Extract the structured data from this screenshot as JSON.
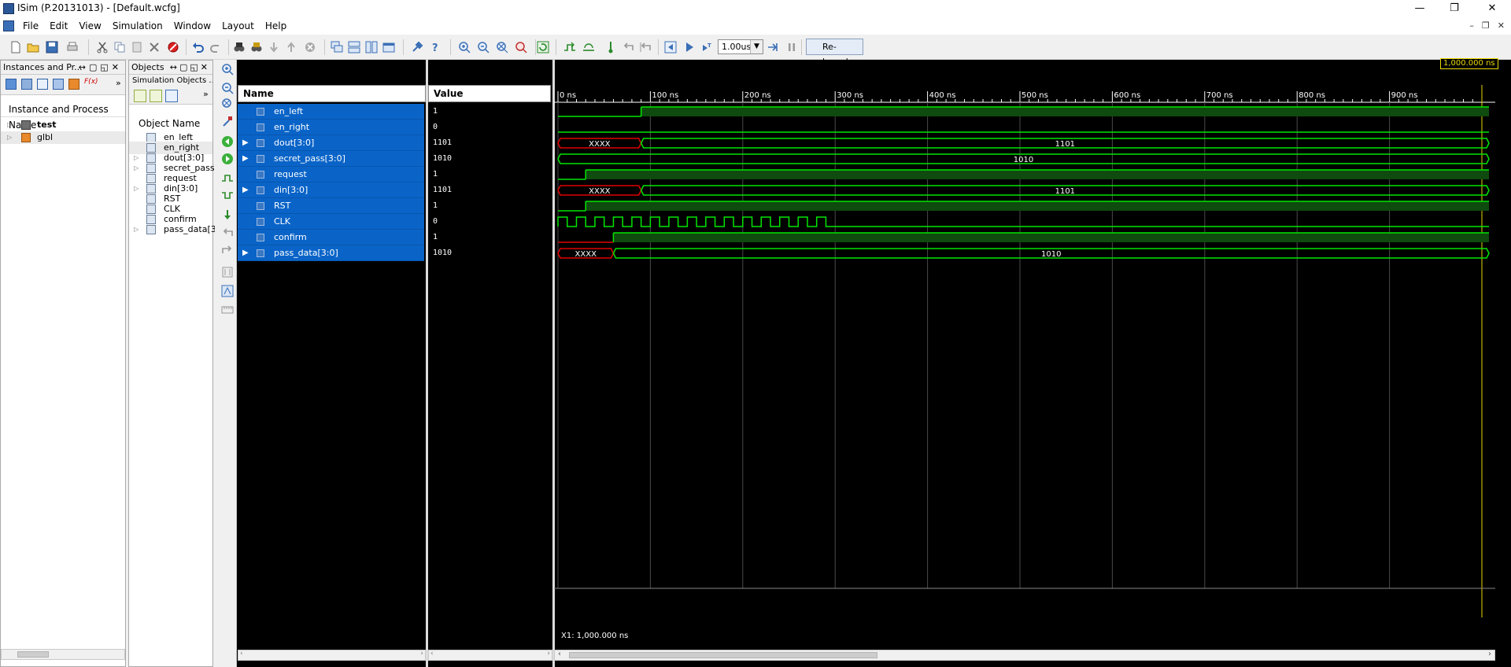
{
  "window": {
    "title": "ISim (P.20131013) - [Default.wcfg]"
  },
  "window_controls": {
    "minimize": "—",
    "maximize": "❐",
    "close": "✕"
  },
  "mdi_controls": {
    "minimize": "–",
    "restore": "❐",
    "close": "✕"
  },
  "menu": [
    "File",
    "Edit",
    "View",
    "Simulation",
    "Window",
    "Layout",
    "Help"
  ],
  "toolbar": {
    "runtime": "1.00us",
    "relaunch": "Re-launch"
  },
  "instances_panel": {
    "title": "Instances and Pr...",
    "column_header": "Instance and Process Name",
    "items": [
      {
        "name": "test",
        "bold": true
      },
      {
        "name": "glbl",
        "bold": false
      }
    ]
  },
  "objects_panel": {
    "title": "Objects",
    "subtitle": "Simulation Objects ...",
    "column_header": "Object Name",
    "items": [
      "en_left",
      "en_right",
      "dout[3:0]",
      "secret_pass",
      "request",
      "din[3:0]",
      "RST",
      "CLK",
      "confirm",
      "pass_data[3"
    ]
  },
  "wave": {
    "name_header": "Name",
    "value_header": "Value",
    "cursor_time": "1,000.000 ns",
    "x1_label": "X1: 1,000.000 ns",
    "time_unit": "ns",
    "time_end": 1000,
    "ticks": [
      {
        "t": 0,
        "label": "0 ns"
      },
      {
        "t": 100,
        "label": "100 ns"
      },
      {
        "t": 200,
        "label": "200 ns"
      },
      {
        "t": 300,
        "label": "300 ns"
      },
      {
        "t": 400,
        "label": "400 ns"
      },
      {
        "t": 500,
        "label": "500 ns"
      },
      {
        "t": 600,
        "label": "600 ns"
      },
      {
        "t": 700,
        "label": "700 ns"
      },
      {
        "t": 800,
        "label": "800 ns"
      },
      {
        "t": 900,
        "label": "900 ns"
      }
    ],
    "signals": [
      {
        "name": "en_left",
        "value": "1",
        "bus": false,
        "type": "bit",
        "transitions": [
          [
            0,
            "0"
          ],
          [
            90,
            "1"
          ]
        ]
      },
      {
        "name": "en_right",
        "value": "0",
        "bus": false,
        "type": "bit",
        "transitions": [
          [
            0,
            "0"
          ]
        ]
      },
      {
        "name": "dout[3:0]",
        "value": "1101",
        "bus": true,
        "type": "bus",
        "segments": [
          [
            0,
            90,
            "XXXX"
          ],
          [
            90,
            1000,
            "1101"
          ]
        ]
      },
      {
        "name": "secret_pass[3:0]",
        "value": "1010",
        "bus": true,
        "type": "bus",
        "segments": [
          [
            0,
            1000,
            "1010"
          ]
        ]
      },
      {
        "name": "request",
        "value": "1",
        "bus": false,
        "type": "bit",
        "transitions": [
          [
            0,
            "0"
          ],
          [
            30,
            "1"
          ]
        ]
      },
      {
        "name": "din[3:0]",
        "value": "1101",
        "bus": true,
        "type": "bus",
        "segments": [
          [
            0,
            90,
            "XXXX"
          ],
          [
            90,
            1000,
            "1101"
          ]
        ]
      },
      {
        "name": "RST",
        "value": "1",
        "bus": false,
        "type": "bit",
        "transitions": [
          [
            0,
            "0"
          ],
          [
            30,
            "1"
          ]
        ]
      },
      {
        "name": "CLK",
        "value": "0",
        "bus": false,
        "type": "clock",
        "period": 20,
        "clock_end": 300
      },
      {
        "name": "confirm",
        "value": "1",
        "bus": false,
        "type": "bit",
        "transitions": [
          [
            0,
            "X"
          ],
          [
            60,
            "1"
          ]
        ]
      },
      {
        "name": "pass_data[3:0]",
        "value": "1010",
        "bus": true,
        "type": "bus",
        "segments": [
          [
            0,
            60,
            "XXXX"
          ],
          [
            60,
            1000,
            "1010"
          ]
        ]
      }
    ]
  },
  "colors": {
    "wave": "#00e600",
    "unknown": "#e00000",
    "selection": "#0a64c8",
    "grid": "#4a4a4a",
    "cursor": "#e8d800"
  }
}
